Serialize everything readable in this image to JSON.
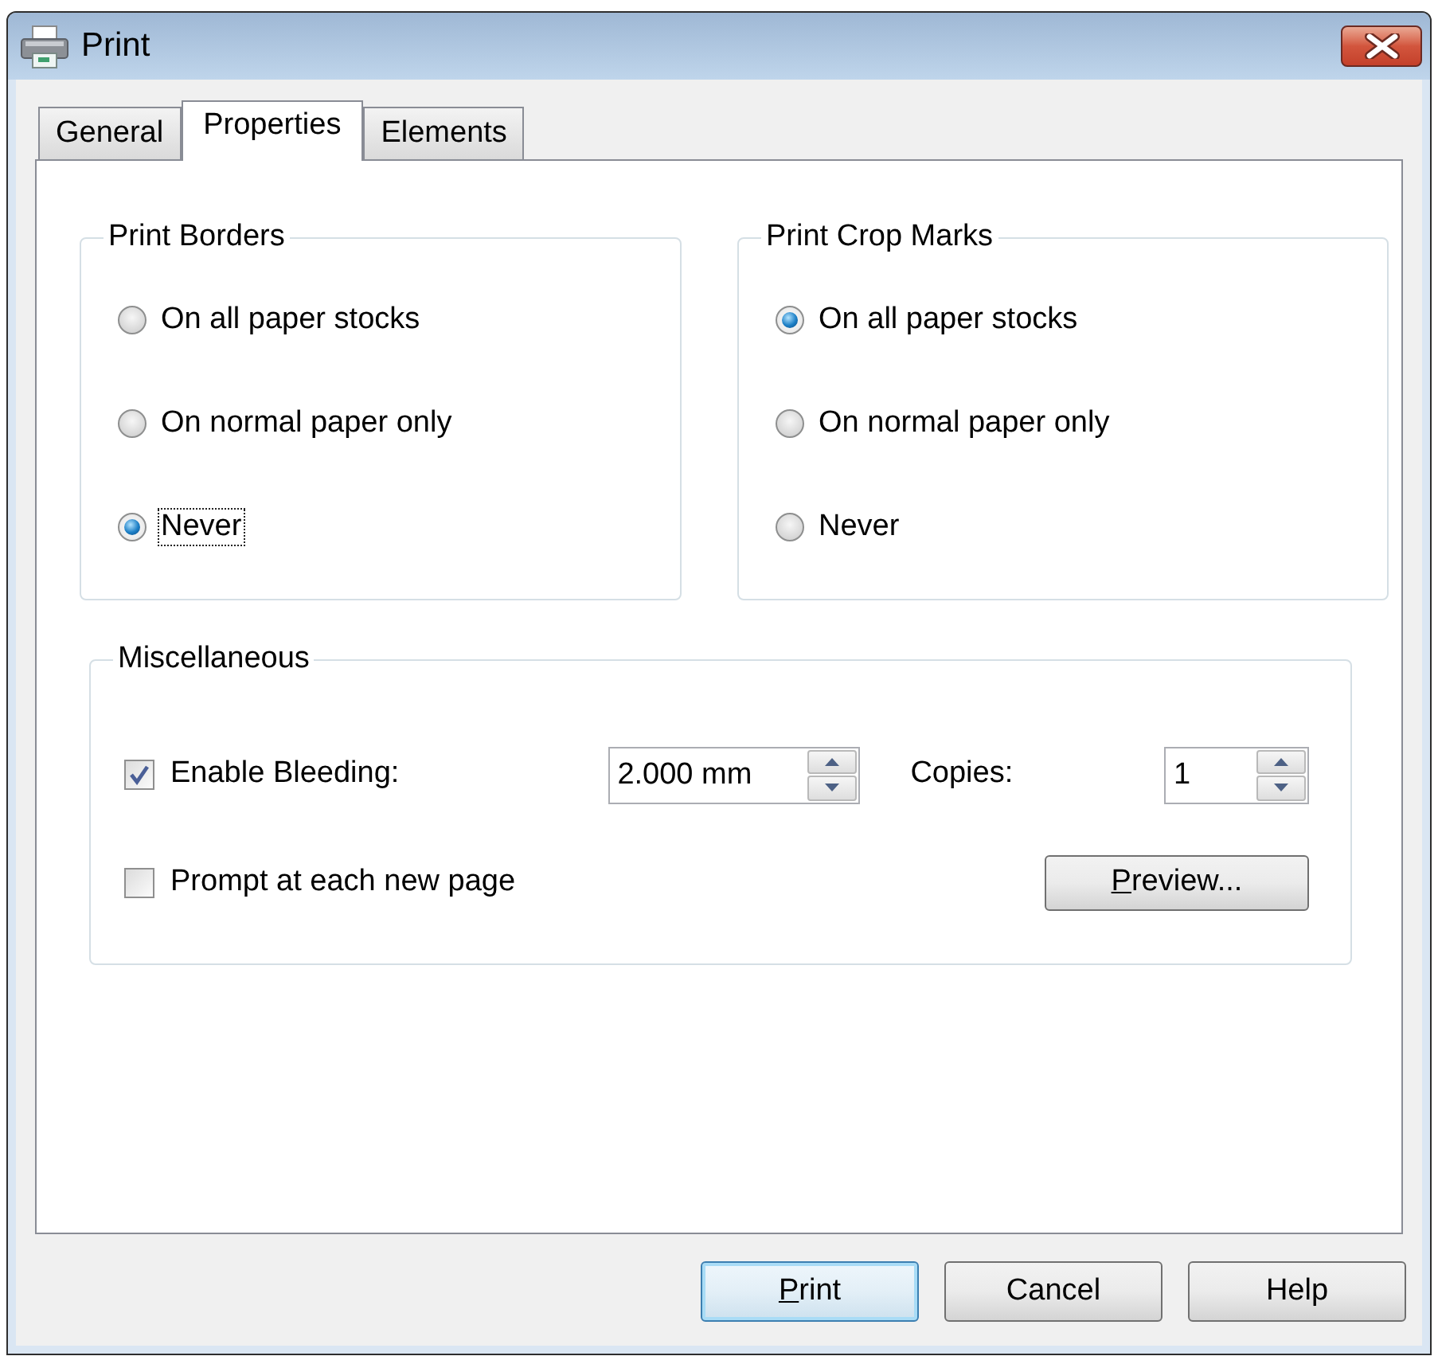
{
  "window": {
    "title": "Print"
  },
  "tabs": [
    {
      "label": "General",
      "selected": false
    },
    {
      "label": "Properties",
      "selected": true
    },
    {
      "label": "Elements",
      "selected": false
    }
  ],
  "groups": [
    {
      "title": "Print Borders",
      "options": [
        {
          "label": "On all paper stocks",
          "selected": false,
          "focused": false
        },
        {
          "label": "On normal paper only",
          "selected": false,
          "focused": false
        },
        {
          "label": "Never",
          "selected": true,
          "focused": true
        }
      ]
    },
    {
      "title": "Print Crop Marks",
      "options": [
        {
          "label": "On all paper stocks",
          "selected": true,
          "focused": false
        },
        {
          "label": "On normal paper only",
          "selected": false,
          "focused": false
        },
        {
          "label": "Never",
          "selected": false,
          "focused": false
        }
      ]
    }
  ],
  "miscellaneous": {
    "title": "Miscellaneous",
    "enable_bleeding": {
      "label": "Enable Bleeding:",
      "checked": true
    },
    "bleeding": {
      "value": "2.000 mm"
    },
    "copies": {
      "label": "Copies:",
      "value": "1"
    },
    "prompt": {
      "label": "Prompt at each new page",
      "checked": false
    },
    "preview_button": {
      "label": "Preview...",
      "mnemonic_underlined": true
    }
  },
  "buttons": [
    {
      "label": "Print",
      "default": true,
      "mnemonic_underlined": true
    },
    {
      "label": "Cancel",
      "default": false,
      "mnemonic_underlined": false
    },
    {
      "label": "Help",
      "default": false,
      "mnemonic_underlined": false
    }
  ]
}
